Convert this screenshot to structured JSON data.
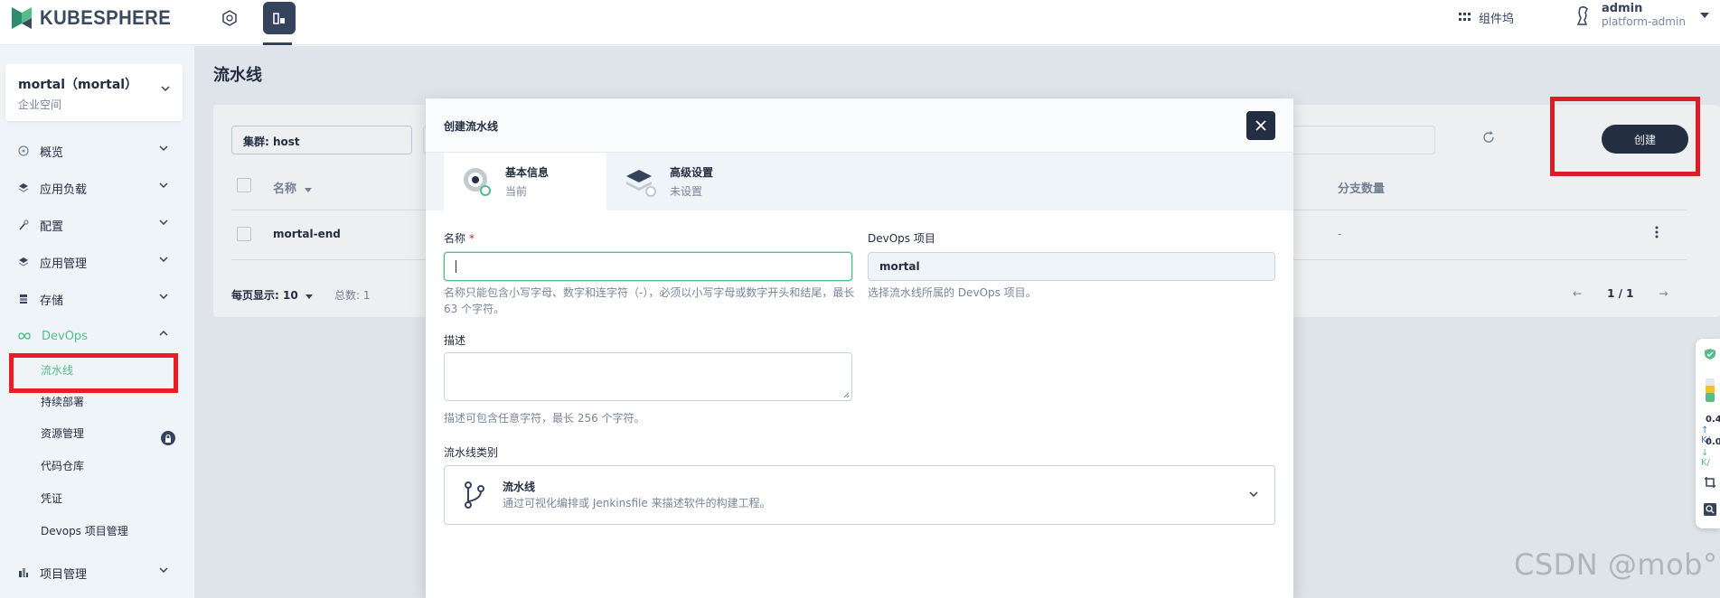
{
  "app": {
    "logo_text": "KUBESPHERE"
  },
  "topbar": {
    "components_label": "组件坞",
    "user_name": "admin",
    "user_role": "platform-admin"
  },
  "sidebar": {
    "workspace_title": "mortal（mortal）",
    "workspace_sub": "企业空间",
    "items": [
      {
        "label": "概览"
      },
      {
        "label": "应用负载"
      },
      {
        "label": "配置"
      },
      {
        "label": "应用管理"
      },
      {
        "label": "存储"
      },
      {
        "label": "DevOps"
      },
      {
        "label": "项目管理"
      }
    ],
    "devops_sub": [
      {
        "label": "流水线"
      },
      {
        "label": "持续部署"
      },
      {
        "label": "资源管理"
      },
      {
        "label": "代码仓库"
      },
      {
        "label": "凭证"
      },
      {
        "label": "Devops 项目管理"
      }
    ]
  },
  "main": {
    "page_title": "流水线",
    "filter_cluster": "集群: host",
    "create_label": "创建",
    "col_name": "名称",
    "col_branches": "分支数量",
    "row_name": "mortal-end",
    "row_branches": "-",
    "per_page": "每页显示: 10",
    "total": "总数: 1",
    "page_info": "1 / 1"
  },
  "modal": {
    "title": "创建流水线",
    "step1_title": "基本信息",
    "step1_sub": "当前",
    "step2_title": "高级设置",
    "step2_sub": "未设置",
    "name_label": "名称",
    "name_required": "*",
    "name_hint": "名称只能包含小写字母、数字和连字符（-），必须以小写字母或数字开头和结尾，最长 63 个字符。",
    "devops_label": "DevOps 项目",
    "devops_value": "mortal",
    "devops_hint": "选择流水线所属的 DevOps 项目。",
    "desc_label": "描述",
    "desc_hint": "描述可包含任意字符，最长 256 个字符。",
    "type_label": "流水线类别",
    "type_title": "流水线",
    "type_desc": "通过可视化编排或 Jenkinsfile 来描述软件的构建工程。"
  },
  "widget": {
    "v1": "0.4",
    "u1": "K/",
    "v2": "0.0",
    "u2": "K/"
  },
  "watermark": "CSDN @mob°",
  "colors": {
    "accent": "#55bc8a",
    "dark": "#242e42",
    "highlight": "#ea1c24"
  }
}
